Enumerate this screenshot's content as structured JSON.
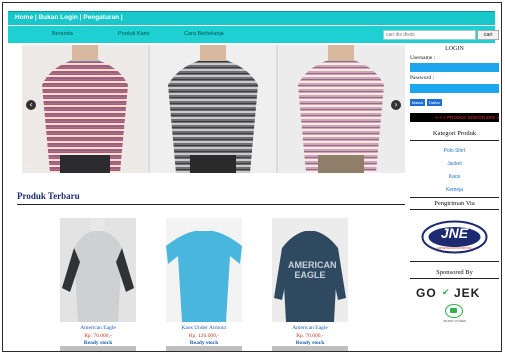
{
  "topbar": {
    "links": "Home | Bukan Login | Pengaturan |"
  },
  "nav": {
    "items": [
      "Beranda",
      "Produk Kami",
      "Cara Berbelanja"
    ]
  },
  "search": {
    "value": "cari dis disini",
    "button": "cari"
  },
  "slider": {
    "prev_icon": "chevron-left-icon",
    "next_icon": "chevron-right-icon",
    "dots": "• • •"
  },
  "login": {
    "title": "LOGIN",
    "username_label": "Username :",
    "password_label": "Password :",
    "login_button": "Masuk",
    "daftar_button": "Daftar"
  },
  "promo": {
    "text": "< < < PRODUK DISKON 20% >"
  },
  "categories": {
    "title": "Kategori Produk",
    "items": [
      "Polo Shirt",
      "Jacket",
      "Kaos",
      "Kemeja"
    ]
  },
  "shipping": {
    "title": "Pengiriman Via",
    "logo_text": "JNE",
    "logo_sub": "EXPRESS ACROSS NATIONS"
  },
  "sponsor": {
    "title": "Sponsored By",
    "logo_text": "GO",
    "logo_text2": "JEK",
    "logo_sub": "INSTANT COURIER"
  },
  "products": {
    "title": "Produk Terbaru",
    "items": [
      {
        "name": "American Eagle",
        "price": "Rp. 70.000,-",
        "stock": "Ready stock"
      },
      {
        "name": "Kaos Under Armour",
        "price": "Rp. 120.000,-",
        "stock": "Ready stock"
      },
      {
        "name": "American Eagle",
        "price": "Rp. 70.000,-",
        "stock": "Ready stock"
      }
    ]
  },
  "colors": {
    "teal": "#18c7c9",
    "blue_field": "#1da6ee",
    "title_blue": "#1a2d72"
  }
}
